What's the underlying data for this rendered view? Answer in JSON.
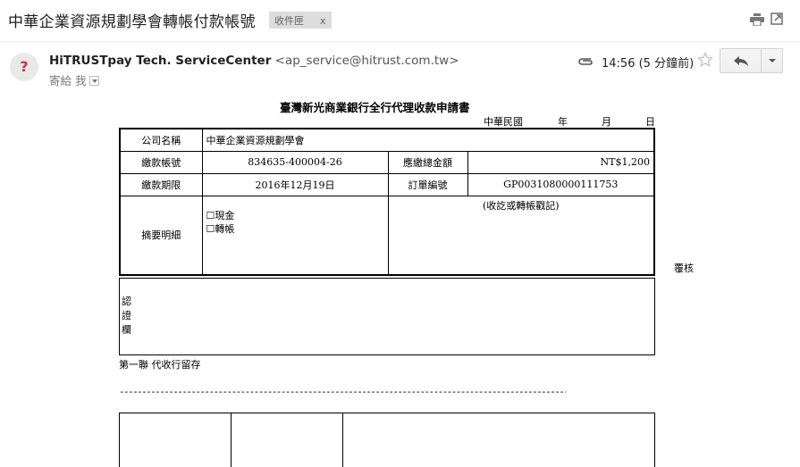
{
  "subject": {
    "title": "中華企業資源規劃學會轉帳付款帳號",
    "label_chip": "收件匣",
    "label_remove": "x"
  },
  "header": {
    "avatar_symbol": "?",
    "sender_name": "HiTRUSTpay Tech. ServiceCenter",
    "sender_email": "<ap_service@hitrust.com.tw>",
    "to_line": "寄給 我",
    "time": "14:56 (5 分鐘前)",
    "icons": [
      "print-icon",
      "new-window-icon",
      "attachment-icon",
      "star-icon",
      "reply-icon",
      "more-icon"
    ]
  },
  "document": {
    "title": "臺灣新光商業銀行全行代理收款申請書",
    "date_prefix": "中華民國",
    "date_year": "年",
    "date_month": "月",
    "date_day": "日",
    "rows": {
      "company_label": "公司名稱",
      "company_value": "中華企業資源規劃學會",
      "account_label": "繳款帳號",
      "account_value": "834635-400004-26",
      "amount_label": "應繳總金額",
      "amount_value": "NT$1,200",
      "deadline_label": "繳款期限",
      "deadline_value": "2016年12月19日",
      "order_label": "訂單編號",
      "order_value": "GP0031080000111753",
      "summary_label": "摘要明細",
      "option_cash": "☐現金",
      "option_transfer": "☐轉帳",
      "stamp_note": "(收訖或轉帳戳記)"
    },
    "review_label": "覆核",
    "cert_label": "認證欄",
    "copy_label": "第一聯 代收行留存",
    "cut_line": "----------------------------------------------------------------------------------------------------------------------"
  }
}
